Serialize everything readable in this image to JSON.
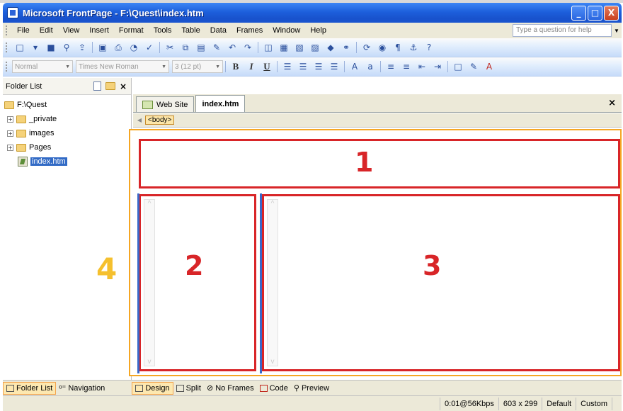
{
  "window": {
    "title": "Microsoft FrontPage - F:\\Quest\\index.htm",
    "minimize": "_",
    "maximize": "□",
    "close": "X"
  },
  "menu": {
    "items": [
      "File",
      "Edit",
      "View",
      "Insert",
      "Format",
      "Tools",
      "Table",
      "Data",
      "Frames",
      "Window",
      "Help"
    ],
    "help_placeholder": "Type a question for help"
  },
  "formatting": {
    "style": "Normal",
    "font": "Times New Roman",
    "size": "3 (12 pt)"
  },
  "folder_list": {
    "title": "Folder List",
    "root": "F:\\Quest",
    "items": [
      "_private",
      "images",
      "Pages"
    ],
    "selected_file": "index.htm"
  },
  "tabs": {
    "web_site": "Web Site",
    "index": "index.htm"
  },
  "quick_tag": "<body>",
  "frames": {
    "top": "1",
    "left": "2",
    "main": "3",
    "outer": "4"
  },
  "bottom_left": {
    "folder_list": "Folder List",
    "navigation": "Navigation"
  },
  "views": [
    "Design",
    "Split",
    "No Frames",
    "Code",
    "Preview"
  ],
  "status": {
    "speed": "0:01@56Kbps",
    "size": "603 x 299",
    "default": "Default",
    "custom": "Custom"
  }
}
